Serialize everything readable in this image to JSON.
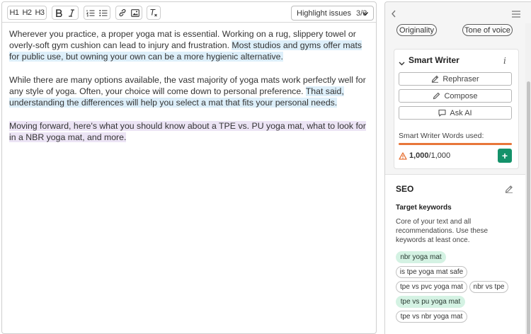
{
  "toolbar": {
    "heading_buttons": [
      "H1",
      "H2",
      "H3"
    ],
    "highlight": {
      "label": "Highlight issues",
      "count": "3/3"
    }
  },
  "editor": {
    "paragraphs": [
      [
        {
          "text": "Wherever you practice, a proper yoga mat is essential. Working on a rug, slippery towel or overly-soft gym cushion can lead to injury and frustration. ",
          "hl": ""
        },
        {
          "text": "Most studios and gyms offer mats for public use, but owning your own can be a more hygienic alternative.",
          "hl": "blue"
        }
      ],
      [
        {
          "text": "While there are many options available, the vast majority of yoga mats work perfectly well for any style of yoga. Often, your choice will come down to personal preference. ",
          "hl": ""
        },
        {
          "text": "That said, understanding the differences will help you select a mat that fits your personal needs.",
          "hl": "blue"
        }
      ],
      [
        {
          "text": "Moving forward, here's what you should know about a TPE vs. PU yoga mat, what to look for in a NBR yoga mat, and more.",
          "hl": "purple"
        }
      ]
    ]
  },
  "panel": {
    "top_pills": [
      "Originality",
      "Tone of voice"
    ],
    "smart_writer": {
      "title": "Smart Writer",
      "buttons": [
        "Rephraser",
        "Compose",
        "Ask AI"
      ],
      "words_label": "Smart Writer Words used:",
      "used": "1,000",
      "limit": "/1,000",
      "used_fraction": 1.0
    },
    "seo": {
      "title": "SEO",
      "subtitle": "Target keywords",
      "description": "Core of your text and all recommendations. Use these keywords at least once.",
      "keywords": [
        {
          "label": "nbr yoga mat",
          "used": true
        },
        {
          "label": "is tpe yoga mat safe",
          "used": false
        },
        {
          "label": "tpe vs pvc yoga mat",
          "used": false
        },
        {
          "label": "nbr vs tpe",
          "used": false
        },
        {
          "label": "tpe vs pu yoga mat",
          "used": true
        },
        {
          "label": "tpe vs nbr yoga mat",
          "used": false
        }
      ]
    }
  },
  "colors": {
    "highlight_blue": "#ddeffa",
    "highlight_purple": "#ece4f5",
    "keyword_used": "#d4f2e3",
    "progress": "#e8763a",
    "add_button": "#14926a",
    "warning": "#e8763a"
  },
  "icons": [
    "bold-icon",
    "italic-icon",
    "ordered-list-icon",
    "bullet-list-icon",
    "link-icon",
    "image-icon",
    "clear-format-icon",
    "chevron-down-icon",
    "chevron-left-icon",
    "hamburger-menu-icon",
    "info-icon",
    "rephrase-icon",
    "compose-icon",
    "ask-ai-icon",
    "warning-icon",
    "plus-icon",
    "edit-icon"
  ]
}
